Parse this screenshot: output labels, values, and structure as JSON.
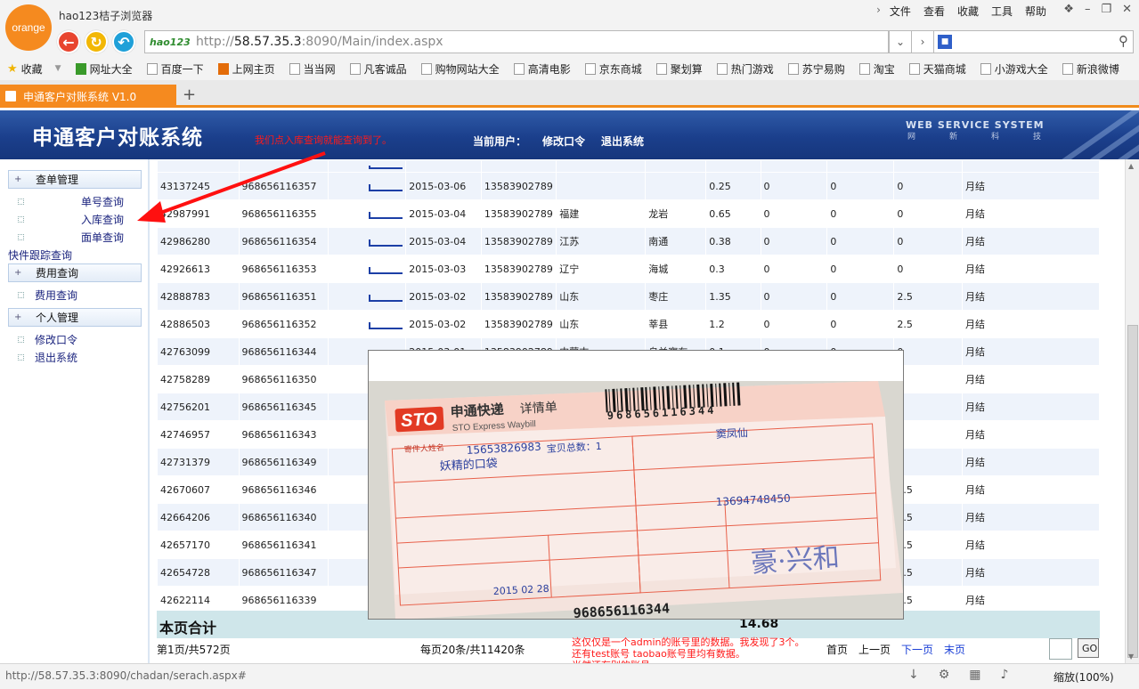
{
  "browser": {
    "logo_text": "orange",
    "title": "hao123桔子浏览器",
    "menu": [
      "文件",
      "查看",
      "收藏",
      "工具",
      "帮助"
    ],
    "address_prefix": "http://",
    "address_host": "58.57.35.3",
    "address_rest": ":8090/Main/index.aspx",
    "addr_logo": "hao123",
    "tab_title": "申通客户对账系统 V1.0",
    "bookmarks": [
      "收藏",
      "网址大全",
      "百度一下",
      "上网主页",
      "当当网",
      "凡客诚品",
      "购物网站大全",
      "高清电影",
      "京东商城",
      "聚划算",
      "热门游戏",
      "苏宁易购",
      "淘宝",
      "天猫商城",
      "小游戏大全",
      "新浪微博"
    ],
    "status_url": "http://58.57.35.3:8090/chadan/serach.aspx#",
    "zoom": "缩放(100%)"
  },
  "header": {
    "title": "申通客户对账系统",
    "annotation": "我们点入库查询就能查询到了。",
    "current_user": "当前用户：",
    "change_password": "修改口令",
    "logout": "退出系统",
    "brand": "WEB SERVICE SYSTEM",
    "brand_sub": [
      "网",
      "新",
      "科",
      "技"
    ]
  },
  "sidebar": {
    "sec1": "查单管理",
    "item_single": "单号查询",
    "item_storage": "入库查询",
    "item_face": "面单查询",
    "plain": "快件跟踪查询",
    "sec2": "费用查询",
    "item_fee": "费用查询",
    "sec3": "个人管理",
    "item_pwd": "修改口令",
    "item_exit": "退出系统"
  },
  "table": {
    "rows": [
      {
        "id": "43137245",
        "no": "968656116357",
        "date": "2015-03-06",
        "phone": "13583902789",
        "prov": "",
        "city": "",
        "w": "0.25",
        "a": "0",
        "b": "0",
        "c": "0",
        "pay": "月结"
      },
      {
        "id": "42987991",
        "no": "968656116355",
        "date": "2015-03-04",
        "phone": "13583902789",
        "prov": "福建",
        "city": "龙岩",
        "w": "0.65",
        "a": "0",
        "b": "0",
        "c": "0",
        "pay": "月结"
      },
      {
        "id": "42986280",
        "no": "968656116354",
        "date": "2015-03-04",
        "phone": "13583902789",
        "prov": "江苏",
        "city": "南通",
        "w": "0.38",
        "a": "0",
        "b": "0",
        "c": "0",
        "pay": "月结"
      },
      {
        "id": "42926613",
        "no": "968656116353",
        "date": "2015-03-03",
        "phone": "13583902789",
        "prov": "辽宁",
        "city": "海城",
        "w": "0.3",
        "a": "0",
        "b": "0",
        "c": "0",
        "pay": "月结"
      },
      {
        "id": "42888783",
        "no": "968656116351",
        "date": "2015-03-02",
        "phone": "13583902789",
        "prov": "山东",
        "city": "枣庄",
        "w": "1.35",
        "a": "0",
        "b": "0",
        "c": "2.5",
        "pay": "月结"
      },
      {
        "id": "42886503",
        "no": "968656116352",
        "date": "2015-03-02",
        "phone": "13583902789",
        "prov": "山东",
        "city": "莘县",
        "w": "1.2",
        "a": "0",
        "b": "0",
        "c": "2.5",
        "pay": "月结"
      },
      {
        "id": "42763099",
        "no": "968656116344",
        "date": "2015-03-01",
        "phone": "13583902789",
        "prov": "内蒙古",
        "city": "乌兰察布",
        "w": "0.1",
        "a": "0",
        "b": "0",
        "c": "0",
        "pay": "月结"
      },
      {
        "id": "42758289",
        "no": "968656116350",
        "date": "",
        "phone": "",
        "prov": "",
        "city": "",
        "w": "",
        "a": "",
        "b": "",
        "c": "0",
        "pay": "月结"
      },
      {
        "id": "42756201",
        "no": "968656116345",
        "date": "",
        "phone": "",
        "prov": "",
        "city": "",
        "w": "",
        "a": "",
        "b": "",
        "c": "0",
        "pay": "月结"
      },
      {
        "id": "42746957",
        "no": "968656116343",
        "date": "",
        "phone": "",
        "prov": "",
        "city": "",
        "w": "",
        "a": "",
        "b": "",
        "c": "0",
        "pay": "月结"
      },
      {
        "id": "42731379",
        "no": "968656116349",
        "date": "",
        "phone": "",
        "prov": "",
        "city": "",
        "w": "",
        "a": "",
        "b": "",
        "c": "0",
        "pay": "月结"
      },
      {
        "id": "42670607",
        "no": "968656116346",
        "date": "",
        "phone": "",
        "prov": "",
        "city": "",
        "w": "",
        "a": "",
        "b": "",
        "c": "2.5",
        "pay": "月结"
      },
      {
        "id": "42664206",
        "no": "968656116340",
        "date": "",
        "phone": "",
        "prov": "",
        "city": "",
        "w": "",
        "a": "",
        "b": "",
        "c": "2.5",
        "pay": "月结"
      },
      {
        "id": "42657170",
        "no": "968656116341",
        "date": "",
        "phone": "",
        "prov": "",
        "city": "",
        "w": "",
        "a": "",
        "b": "",
        "c": "2.5",
        "pay": "月结"
      },
      {
        "id": "42654728",
        "no": "968656116347",
        "date": "",
        "phone": "",
        "prov": "",
        "city": "",
        "w": "",
        "a": "",
        "b": "",
        "c": "2.5",
        "pay": "月结"
      },
      {
        "id": "42622114",
        "no": "968656116339",
        "date": "",
        "phone": "",
        "prov": "",
        "city": "",
        "w": "",
        "a": "",
        "b": "",
        "c": "2.5",
        "pay": "月结"
      }
    ],
    "total_label": "本页合计",
    "total_value": "14.68"
  },
  "pager": {
    "page": "第1页/共572页",
    "per": "每页20条/共11420条",
    "note1": "这仅仅是一个admin的账号里的数据。我发现了3个。",
    "note2": "还有test账号 taobao账号里均有数据。",
    "note3": "当然还有别的账号。。",
    "first": "首页",
    "prev": "上一页",
    "next": "下一页",
    "last": "末页",
    "go": "GO"
  },
  "waybill": {
    "brand": "STO",
    "company": "申通快递",
    "company_en": "STO Express Waybill",
    "title": "详情单",
    "number": "968656116344",
    "number_bottom": "968656116344",
    "phone": "15653826983",
    "receiver": "窦凤仙",
    "receiver_phone": "13694748450",
    "sender_label": "寄件人姓名",
    "item_label": "宝贝总数：1",
    "shop": "妖精的口袋",
    "date": "2015 02 28",
    "stamp": "豪·兴和",
    "accent": "#e8604a"
  }
}
